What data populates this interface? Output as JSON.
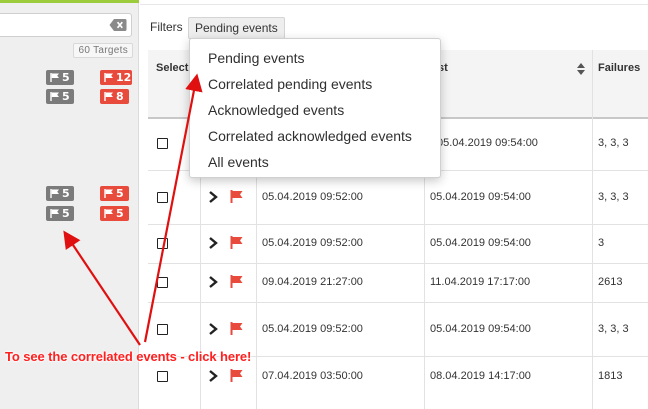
{
  "sidebar": {
    "targets_label": "60 Targets",
    "badges": [
      {
        "gray": "5",
        "red": "12"
      },
      {
        "gray": "5",
        "red": "8"
      },
      {
        "gray": "5",
        "red": "5"
      },
      {
        "gray": "5",
        "red": "5"
      }
    ]
  },
  "filters": {
    "label": "Filters",
    "selected": "Pending events",
    "options": [
      "Pending events",
      "Correlated pending events",
      "Acknowledged events",
      "Correlated acknowledged events",
      "All events"
    ]
  },
  "table": {
    "headers": {
      "select": "Select",
      "last": "st",
      "failures": "Failures"
    },
    "rows": [
      {
        "first": "",
        "last": "05.04.2019 09:54:00",
        "failures": "3, 3, 3"
      },
      {
        "first": "05.04.2019 09:52:00",
        "last": "05.04.2019 09:54:00",
        "failures": "3, 3, 3"
      },
      {
        "first": "05.04.2019 09:52:00",
        "last": "05.04.2019 09:54:00",
        "failures": "3"
      },
      {
        "first": "09.04.2019 21:27:00",
        "last": "11.04.2019 17:17:00",
        "failures": "2613"
      },
      {
        "first": "05.04.2019 09:52:00",
        "last": "05.04.2019 09:54:00",
        "failures": "3, 3, 3"
      },
      {
        "first": "07.04.2019 03:50:00",
        "last": "08.04.2019 14:17:00",
        "failures": "1813"
      }
    ]
  },
  "annotation": {
    "text": "To see the correlated events - click here!",
    "color": "#ff2020"
  },
  "colors": {
    "accent_green": "#9ccb3c",
    "badge_gray": "#7b7b7b",
    "badge_red": "#e84a3c"
  }
}
